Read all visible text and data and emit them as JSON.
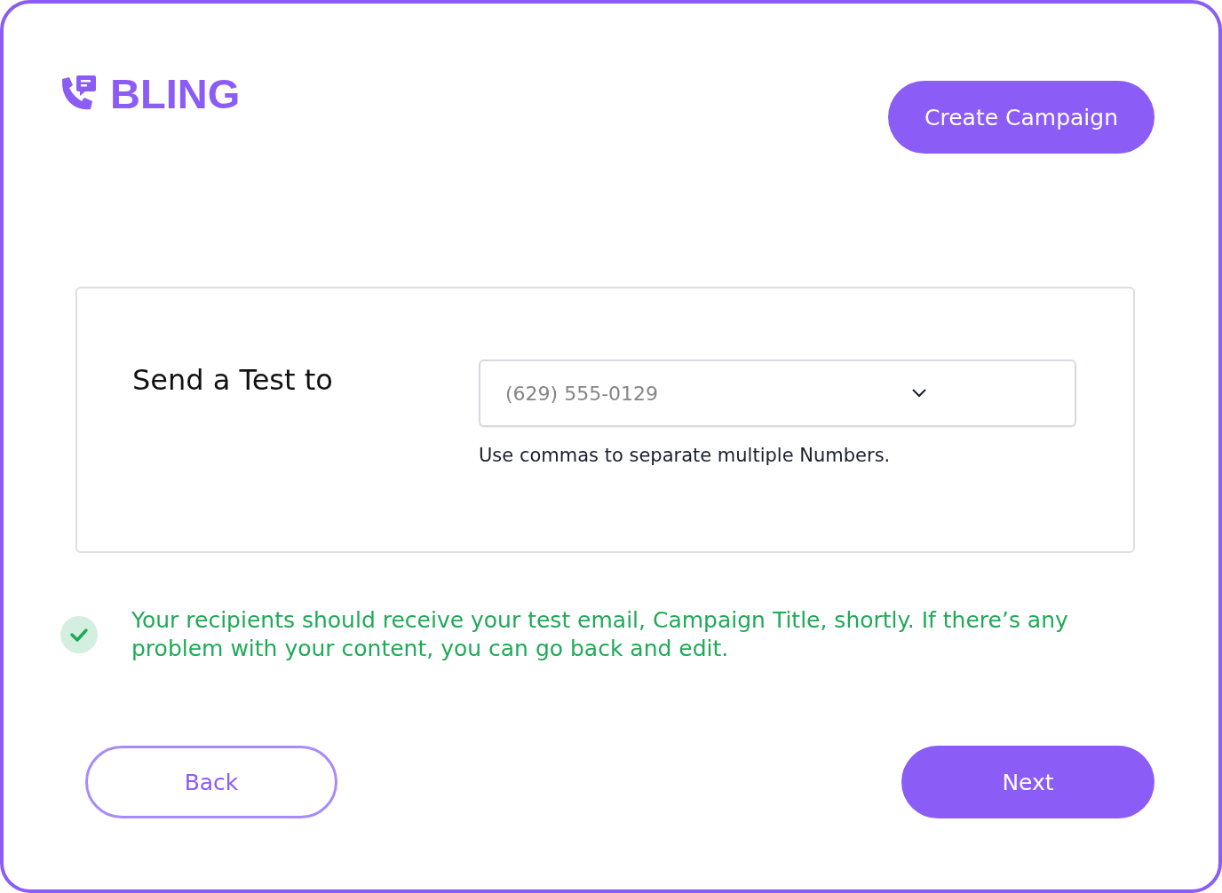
{
  "logo": {
    "text": "BLING"
  },
  "header": {
    "create_button": "Create Campaign"
  },
  "form": {
    "label": "Send a Test to",
    "recipient_field": {
      "placeholder": "(629) 555-0129"
    },
    "hint": "Use commas to separate multiple Numbers."
  },
  "notice": {
    "text": "Your recipients should receive your test email, Campaign Title, shortly. If there’s any problem with your content, you can go back and edit."
  },
  "buttons": [
    {
      "label": "Back",
      "kind": "secondary"
    },
    {
      "label": "Next",
      "kind": "primary"
    }
  ]
}
